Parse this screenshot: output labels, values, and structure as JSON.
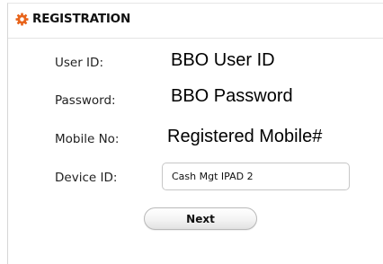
{
  "header": {
    "title": "REGISTRATION",
    "icon": "gear-icon",
    "icon_color": "#e8641b"
  },
  "form": {
    "user_id": {
      "label": "User ID:",
      "value": "BBO User ID"
    },
    "password": {
      "label": "Password:",
      "value": "BBO Password"
    },
    "mobile": {
      "label": "Mobile No:",
      "value": "Registered Mobile#"
    },
    "device": {
      "label": "Device ID:",
      "value": "Cash Mgt IPAD 2"
    }
  },
  "actions": {
    "next_label": "Next"
  }
}
